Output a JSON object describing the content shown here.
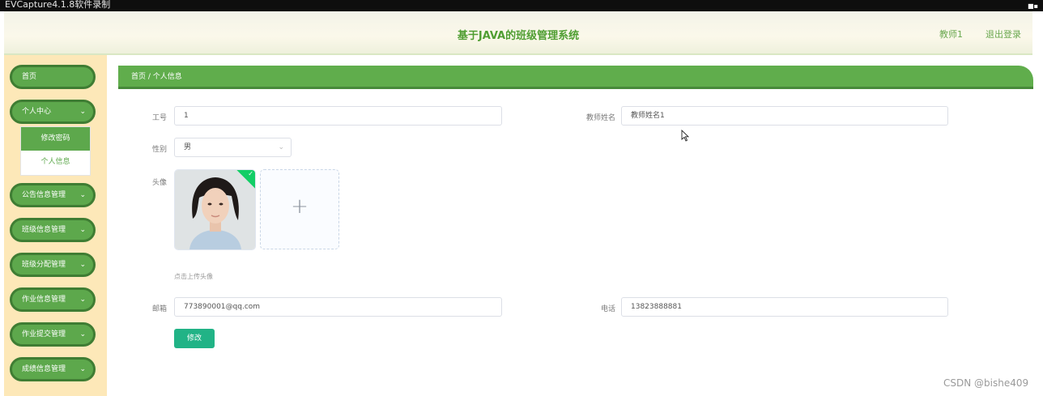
{
  "capture": {
    "title": "EVCapture4.1.8软件录制"
  },
  "header": {
    "title": "基于JAVA的班级管理系统",
    "user": "教师1",
    "logout": "退出登录"
  },
  "sidebar": {
    "items": [
      {
        "label": "首页"
      },
      {
        "label": "个人中心"
      },
      {
        "label": "公告信息管理"
      },
      {
        "label": "班级信息管理"
      },
      {
        "label": "班级分配管理"
      },
      {
        "label": "作业信息管理"
      },
      {
        "label": "作业提交管理"
      },
      {
        "label": "成绩信息管理"
      }
    ],
    "submenu": [
      {
        "label": "修改密码",
        "active": true
      },
      {
        "label": "个人信息",
        "active": false
      }
    ]
  },
  "breadcrumb": {
    "text": "首页 / 个人信息"
  },
  "form": {
    "gonghao": {
      "label": "工号",
      "value": "1"
    },
    "name": {
      "label": "教师姓名",
      "value": "教师姓名1"
    },
    "gender": {
      "label": "性别",
      "value": "男"
    },
    "avatar": {
      "label": "头像",
      "hint": "点击上传头像"
    },
    "email": {
      "label": "邮箱",
      "value": "773890001@qq.com"
    },
    "phone": {
      "label": "电话",
      "value": "13823888881"
    },
    "submit": "修改"
  },
  "watermark": "CSDN @bishe409",
  "colors": {
    "accent": "#5da84c",
    "button": "#21b386",
    "sidebar_bg": "#fde8b8"
  }
}
